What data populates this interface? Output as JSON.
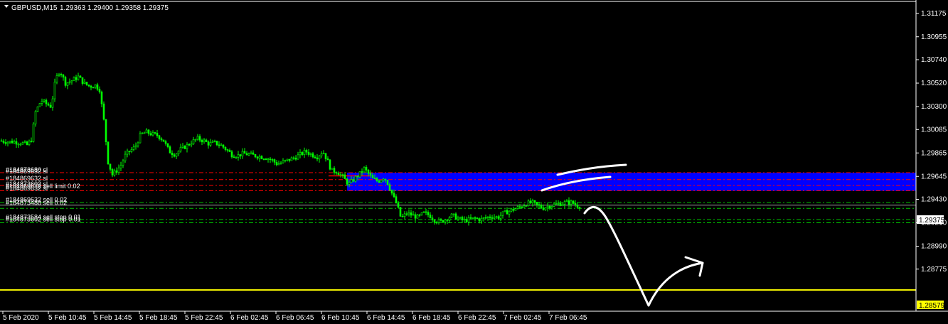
{
  "header": {
    "symbol_label": "GBPUSD,M15",
    "ohlc": "1.29363 1.29400 1.29358 1.29375"
  },
  "colors": {
    "background": "#000000",
    "candle": "#00ff00",
    "axis": "#ffffff",
    "sell_limit_zone": "#0000ff",
    "order_line_red": "#ff0000",
    "order_line_green": "#00c000",
    "support_line": "#ffff00",
    "annotation": "#ffffff"
  },
  "chart_data": {
    "type": "candlestick",
    "ylim": [
      1.2838,
      1.313
    ],
    "y_ticks": [
      "1.31175",
      "1.30955",
      "1.30740",
      "1.30520",
      "1.30300",
      "1.30085",
      "1.29865",
      "1.29645",
      "1.29430",
      "1.29210",
      "1.28990",
      "1.28775"
    ],
    "x_ticks": [
      "5 Feb 2020",
      "5 Feb 10:45",
      "5 Feb 14:45",
      "5 Feb 18:45",
      "5 Feb 22:45",
      "6 Feb 02:45",
      "6 Feb 06:45",
      "6 Feb 10:45",
      "6 Feb 14:45",
      "6 Feb 18:45",
      "6 Feb 22:45",
      "7 Feb 02:45",
      "7 Feb 06:45"
    ],
    "current_price": "1.29375",
    "support_price": "1.28579",
    "close_path": [
      [
        0,
        1.2998
      ],
      [
        10,
        1.2997
      ],
      [
        20,
        1.2997
      ],
      [
        30,
        1.2996
      ],
      [
        38,
        1.2994
      ],
      [
        44,
        1.2999
      ],
      [
        50,
        1.3025
      ],
      [
        58,
        1.3036
      ],
      [
        64,
        1.3033
      ],
      [
        72,
        1.303
      ],
      [
        78,
        1.3055
      ],
      [
        84,
        1.3064
      ],
      [
        92,
        1.3052
      ],
      [
        100,
        1.3054
      ],
      [
        110,
        1.3058
      ],
      [
        118,
        1.3052
      ],
      [
        126,
        1.3049
      ],
      [
        134,
        1.305
      ],
      [
        140,
        1.3046
      ],
      [
        146,
        1.3017
      ],
      [
        152,
        1.2978
      ],
      [
        158,
        1.2966
      ],
      [
        164,
        1.297
      ],
      [
        170,
        1.2975
      ],
      [
        176,
        1.2984
      ],
      [
        182,
        1.2988
      ],
      [
        190,
        1.2992
      ],
      [
        198,
        1.3004
      ],
      [
        206,
        1.3006
      ],
      [
        214,
        1.3004
      ],
      [
        222,
        1.3003
      ],
      [
        230,
        1.2998
      ],
      [
        238,
        1.2988
      ],
      [
        246,
        1.2985
      ],
      [
        254,
        1.299
      ],
      [
        262,
        1.2993
      ],
      [
        270,
        1.2997
      ],
      [
        278,
        1.3
      ],
      [
        286,
        1.2998
      ],
      [
        294,
        1.2995
      ],
      [
        302,
        1.2996
      ],
      [
        310,
        1.2994
      ],
      [
        318,
        1.299
      ],
      [
        326,
        1.2985
      ],
      [
        334,
        1.2984
      ],
      [
        342,
        1.2986
      ],
      [
        350,
        1.2985
      ],
      [
        358,
        1.2984
      ],
      [
        366,
        1.2983
      ],
      [
        374,
        1.2982
      ],
      [
        382,
        1.298
      ],
      [
        390,
        1.2976
      ],
      [
        398,
        1.2978
      ],
      [
        406,
        1.298
      ],
      [
        414,
        1.2982
      ],
      [
        422,
        1.2985
      ],
      [
        430,
        1.2988
      ],
      [
        438,
        1.2985
      ],
      [
        446,
        1.2983
      ],
      [
        454,
        1.2988
      ],
      [
        460,
        1.298
      ],
      [
        466,
        1.297
      ],
      [
        474,
        1.2969
      ],
      [
        482,
        1.2964
      ],
      [
        490,
        1.2957
      ],
      [
        498,
        1.2962
      ],
      [
        506,
        1.2967
      ],
      [
        512,
        1.2972
      ],
      [
        518,
        1.2967
      ],
      [
        524,
        1.2962
      ],
      [
        532,
        1.296
      ],
      [
        540,
        1.2964
      ],
      [
        546,
        1.2957
      ],
      [
        552,
        1.2947
      ],
      [
        558,
        1.2938
      ],
      [
        564,
        1.2925
      ],
      [
        572,
        1.293
      ],
      [
        580,
        1.2928
      ],
      [
        588,
        1.2926
      ],
      [
        596,
        1.293
      ],
      [
        604,
        1.2928
      ],
      [
        612,
        1.2923
      ],
      [
        620,
        1.2922
      ],
      [
        628,
        1.2925
      ],
      [
        636,
        1.2928
      ],
      [
        644,
        1.2925
      ],
      [
        652,
        1.2923
      ],
      [
        660,
        1.2924
      ],
      [
        668,
        1.2925
      ],
      [
        676,
        1.2924
      ],
      [
        684,
        1.2926
      ],
      [
        692,
        1.2927
      ],
      [
        700,
        1.2926
      ],
      [
        708,
        1.293
      ],
      [
        716,
        1.2932
      ],
      [
        724,
        1.2934
      ],
      [
        732,
        1.2936
      ],
      [
        740,
        1.2939
      ],
      [
        748,
        1.294
      ],
      [
        756,
        1.2937
      ],
      [
        764,
        1.2935
      ],
      [
        772,
        1.2937
      ],
      [
        780,
        1.2938
      ],
      [
        788,
        1.2939
      ],
      [
        796,
        1.294
      ],
      [
        804,
        1.294
      ],
      [
        812,
        1.2937
      ],
      [
        816,
        1.29375
      ]
    ],
    "order_lines": [
      {
        "price": 1.2968,
        "color": "#ff0000"
      },
      {
        "price": 1.29615,
        "color": "#ff0000"
      },
      {
        "price": 1.2956,
        "color": "#ff0000"
      },
      {
        "price": 1.2951,
        "color": "#ff0000"
      },
      {
        "price": 1.294,
        "color": "#00c000"
      },
      {
        "price": 1.29345,
        "color": "#00c000"
      },
      {
        "price": 1.2924,
        "color": "#00c000"
      },
      {
        "price": 1.2921,
        "color": "#00c000"
      }
    ],
    "sell_limit_zone": {
      "top": 1.2968,
      "bottom": 1.2951
    },
    "order_labels": [
      {
        "price": 1.29695,
        "text": "#184873680 sl"
      },
      {
        "price": 1.2968,
        "text": "#184869632 sl"
      },
      {
        "price": 1.29615,
        "text": "#184869632 sl"
      },
      {
        "price": 1.2956,
        "text": "#184873602 sl"
      },
      {
        "price": 1.2954,
        "text": "#184869632 sell limit 0.02"
      },
      {
        "price": 1.2952,
        "text": "#184869632 sl"
      },
      {
        "price": 1.29415,
        "text": "#184869632 sell 0.02"
      },
      {
        "price": 1.29385,
        "text": "#184873488 sell 0.02"
      },
      {
        "price": 1.2925,
        "text": "#184873584 sell stop 0.01"
      },
      {
        "price": 1.2923,
        "text": "#184873602 sell stop 0.01"
      }
    ]
  }
}
